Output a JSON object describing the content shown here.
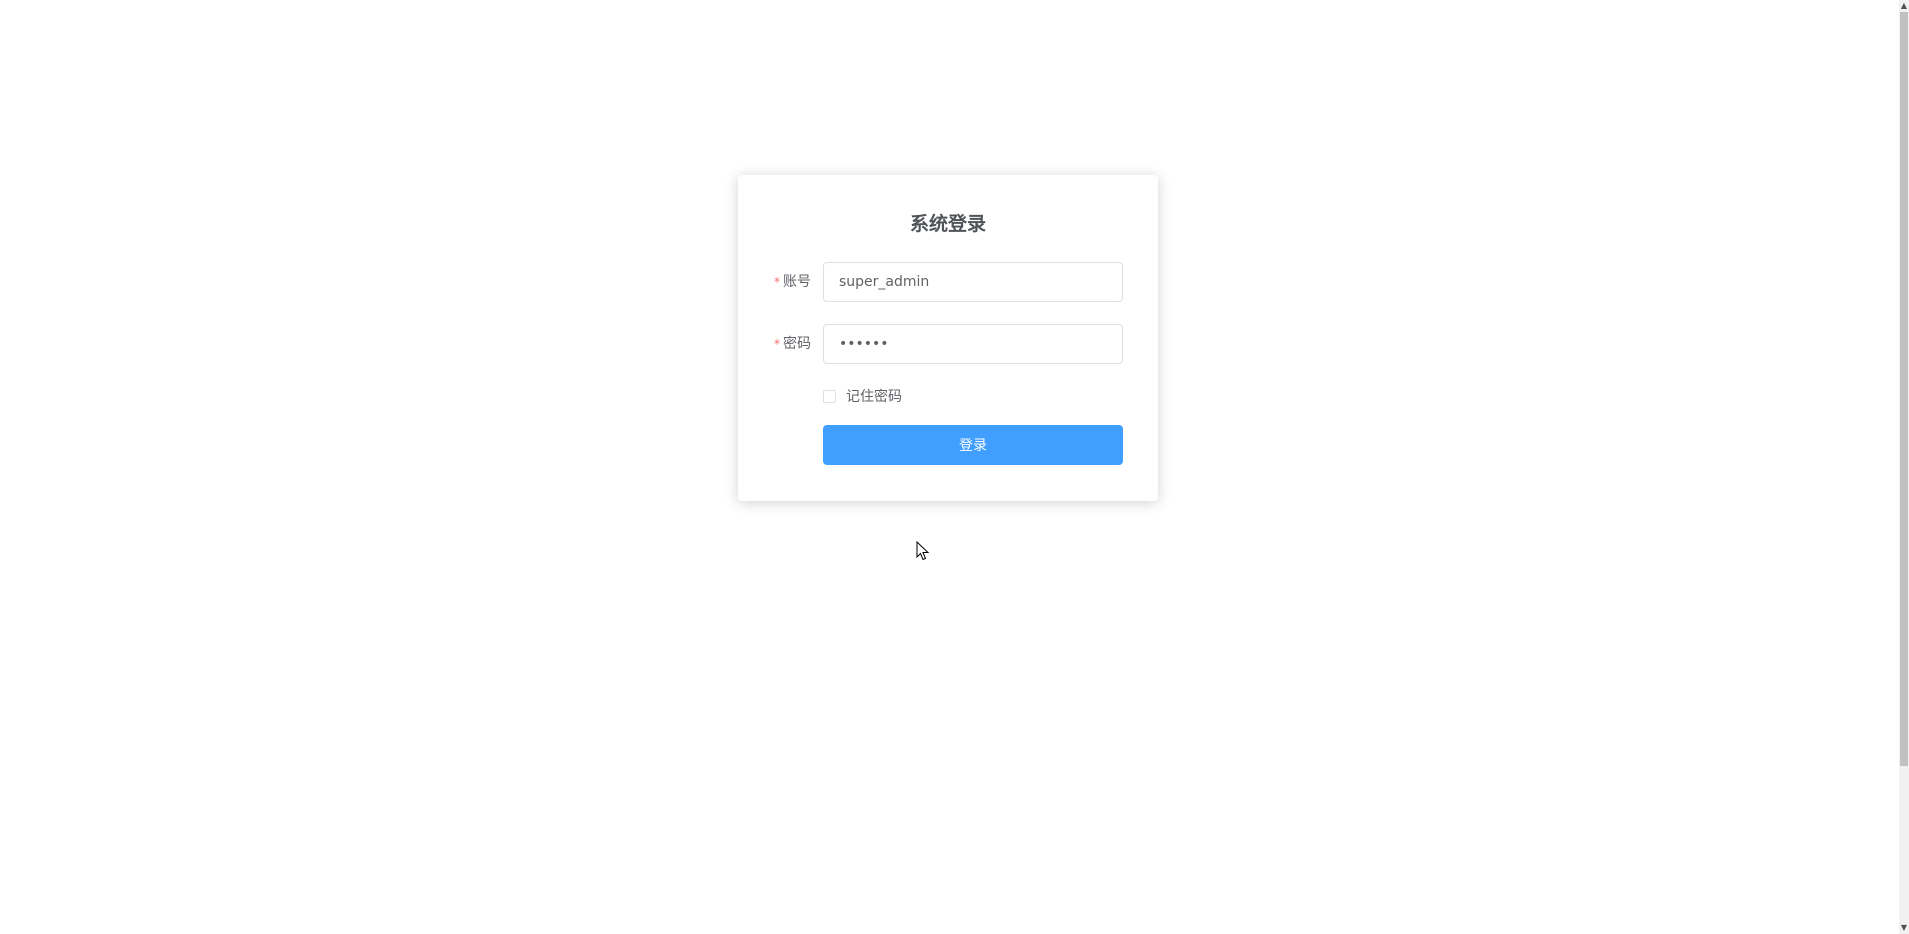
{
  "login": {
    "title": "系统登录",
    "account_label": "账号",
    "account_value": "super_admin",
    "password_label": "密码",
    "password_value": "123456",
    "required_mark": "*",
    "remember_label": "记住密码",
    "remember_checked": false,
    "submit_label": "登录"
  },
  "colors": {
    "primary": "#409eff",
    "required": "#f56c6c",
    "text": "#606266",
    "border": "#dcdfe6"
  }
}
